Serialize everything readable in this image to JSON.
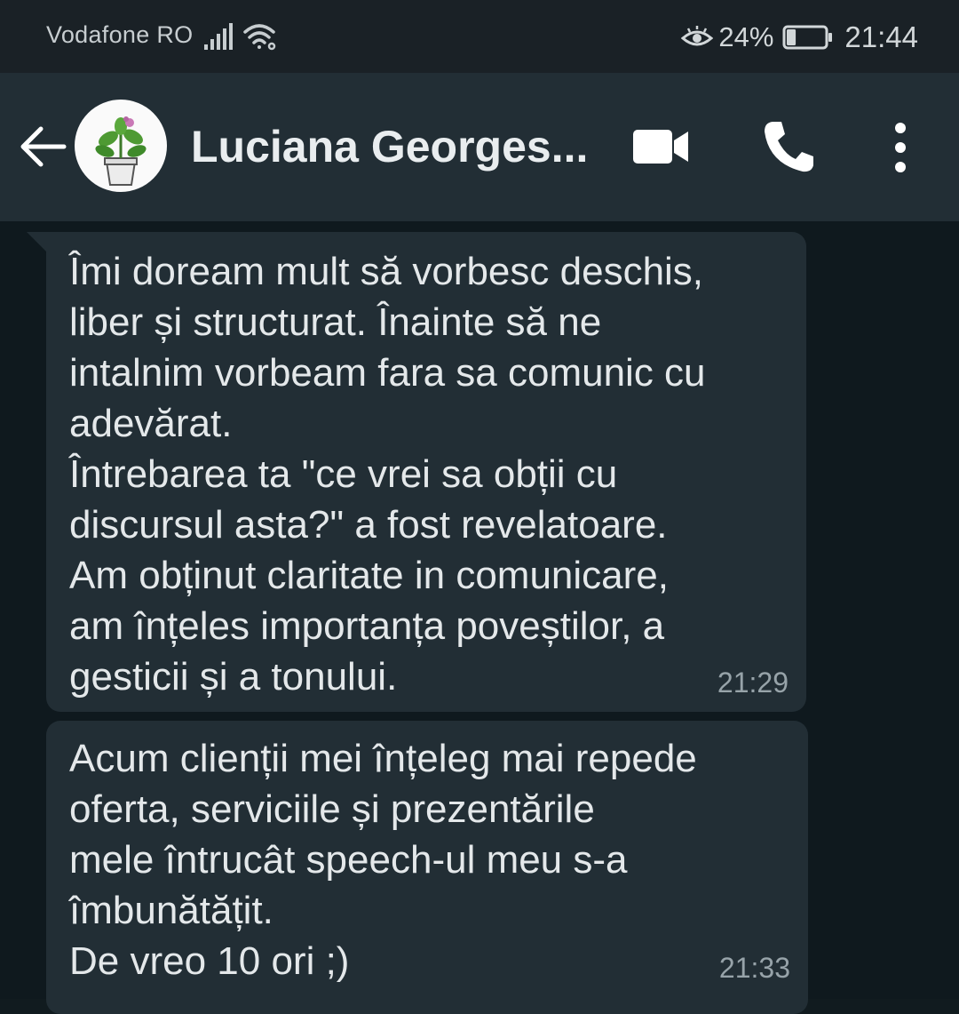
{
  "status_bar": {
    "carrier": "Vodafone RO",
    "battery_percent": "24%",
    "battery_level": 0.24,
    "time": "21:44",
    "icons": [
      "signal-icon",
      "wifi-icon",
      "eye-comfort-icon",
      "battery-icon"
    ]
  },
  "header": {
    "contact_name": "Luciana Georges...",
    "avatar": "potted-plant-avatar",
    "actions": [
      "back-arrow-icon",
      "video-call-icon",
      "phone-call-icon",
      "more-options-icon"
    ]
  },
  "messages": [
    {
      "text": "Îmi doream mult să vorbesc deschis,\nliber și structurat. Înainte să ne\nintalnim vorbeam fara sa comunic cu\nadevărat.\nÎntrebarea ta \"ce vrei sa obții cu\ndiscursul asta?\" a  fost revelatoare.\nAm obținut claritate in comunicare,\nam înțeles importanța poveștilor, a\ngesticii și a tonului.",
      "time": "21:29"
    },
    {
      "text": "Acum clienții mei înțeleg mai repede\noferta, serviciile și prezentările\nmele întrucât speech-ul meu s-a\nîmbunătățit.\nDe vreo 10 ori ;)",
      "time": "21:33"
    }
  ],
  "colors": {
    "status_bar_bg": "#1a2126",
    "app_bar_bg": "#222e35",
    "chat_bg": "#0f191e",
    "bubble_bg": "#222e35",
    "text": "#e4e8ea",
    "timestamp": "#97a3a9"
  }
}
